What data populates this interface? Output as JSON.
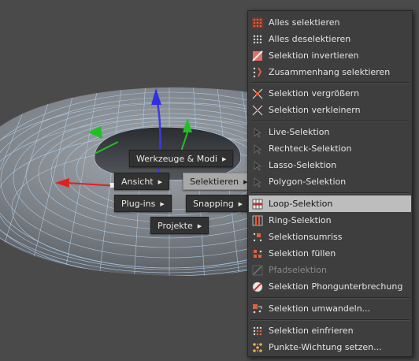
{
  "hotbox": {
    "werkzeuge": "Werkzeuge & Modi",
    "ansicht": "Ansicht",
    "selektieren": "Selektieren",
    "plugins": "Plug-ins",
    "snapping": "Snapping",
    "projekte": "Projekte"
  },
  "menu": {
    "items": [
      {
        "label": "Alles selektieren",
        "icon": "select-all-icon"
      },
      {
        "label": "Alles deselektieren",
        "icon": "deselect-all-icon"
      },
      {
        "label": "Selektion invertieren",
        "icon": "invert-selection-icon"
      },
      {
        "label": "Zusammenhang selektieren",
        "icon": "select-connected-icon"
      },
      {
        "label": "Selektion vergrößern",
        "icon": "grow-selection-icon"
      },
      {
        "label": "Selektion verkleinern",
        "icon": "shrink-selection-icon"
      },
      {
        "label": "Live-Selektion",
        "icon": "live-selection-icon"
      },
      {
        "label": "Rechteck-Selektion",
        "icon": "rectangle-selection-icon"
      },
      {
        "label": "Lasso-Selektion",
        "icon": "lasso-selection-icon"
      },
      {
        "label": "Polygon-Selektion",
        "icon": "polygon-selection-icon"
      },
      {
        "label": "Loop-Selektion",
        "icon": "loop-selection-icon",
        "highlighted": true
      },
      {
        "label": "Ring-Selektion",
        "icon": "ring-selection-icon"
      },
      {
        "label": "Selektionsumriss",
        "icon": "selection-outline-icon"
      },
      {
        "label": "Selektion füllen",
        "icon": "fill-selection-icon"
      },
      {
        "label": "Pfadselektion",
        "icon": "path-selection-icon",
        "disabled": true
      },
      {
        "label": "Selektion Phongunterbrechung",
        "icon": "phong-break-selection-icon"
      },
      {
        "label": "Selektion umwandeln...",
        "icon": "convert-selection-icon"
      },
      {
        "label": "Selektion einfrieren",
        "icon": "freeze-selection-icon"
      },
      {
        "label": "Punkte-Wichtung setzen...",
        "icon": "set-point-weight-icon"
      }
    ]
  },
  "colors": {
    "viewport_bg": "#4a4a4a",
    "mesh_fill": "#8a9096",
    "mesh_wire": "#b8d4f0",
    "axis_x": "#e02020",
    "axis_y": "#20c020",
    "axis_z": "#3030e0",
    "highlight": "#bdbdbd"
  }
}
